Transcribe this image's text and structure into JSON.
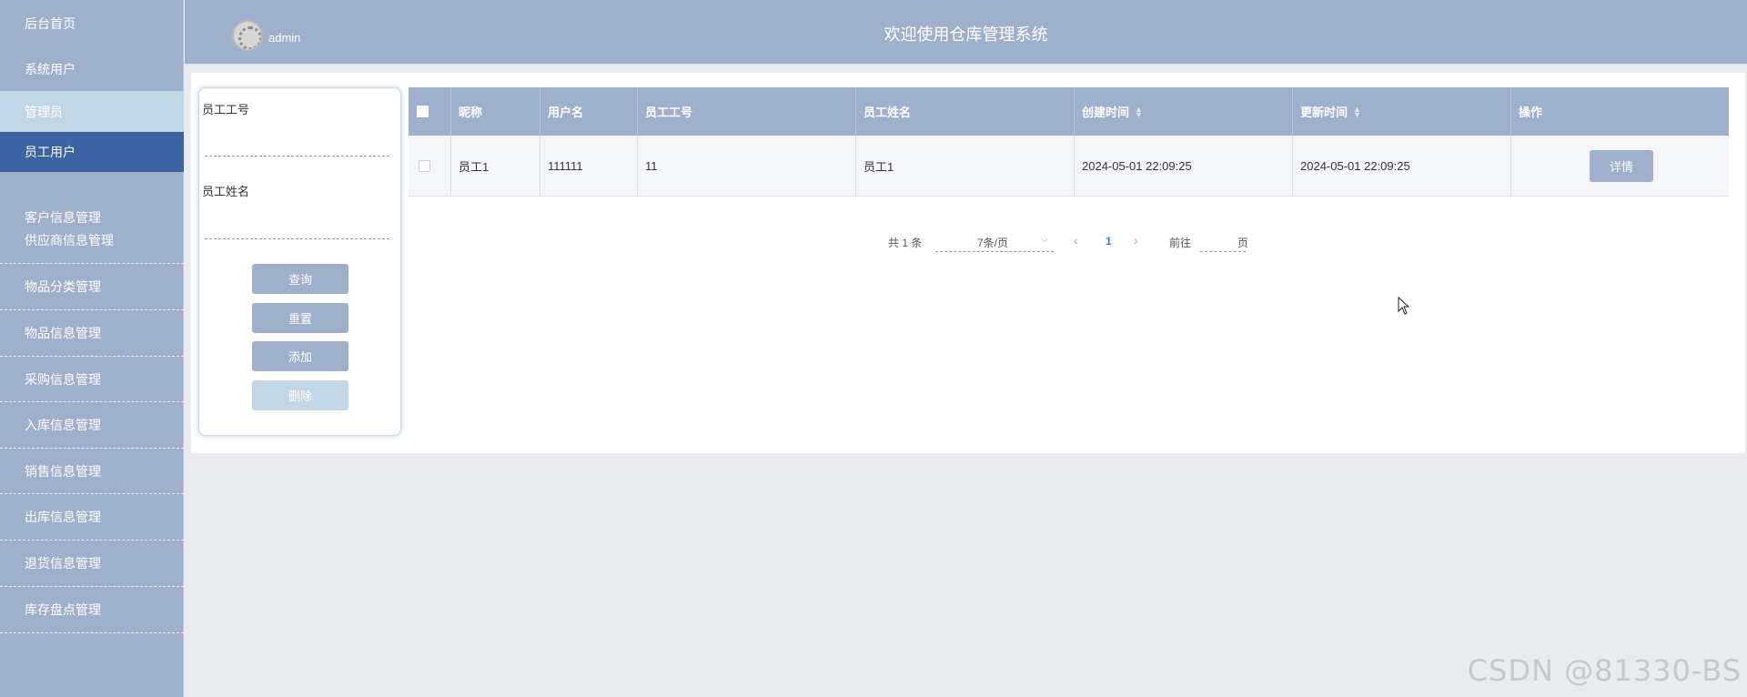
{
  "sidebar": {
    "items": [
      {
        "label": "后台首页"
      },
      {
        "label": "系统用户"
      },
      {
        "label": "管理员"
      },
      {
        "label": "员工用户"
      },
      {
        "label": "客户信息管理"
      },
      {
        "label": "供应商信息管理"
      },
      {
        "label": "物品分类管理"
      },
      {
        "label": "物品信息管理"
      },
      {
        "label": "采购信息管理"
      },
      {
        "label": "入库信息管理"
      },
      {
        "label": "销售信息管理"
      },
      {
        "label": "出库信息管理"
      },
      {
        "label": "退货信息管理"
      },
      {
        "label": "库存盘点管理"
      }
    ],
    "active": "员工用户"
  },
  "header": {
    "username": "admin",
    "title": "欢迎使用仓库管理系统"
  },
  "search": {
    "employee_no_label": "员工工号",
    "employee_no_value": "",
    "employee_name_label": "员工姓名",
    "employee_name_value": "",
    "query_btn": "查询",
    "reset_btn": "重置",
    "add_btn": "添加",
    "delete_btn": "删除"
  },
  "table": {
    "columns": [
      "昵称",
      "用户名",
      "员工工号",
      "员工姓名",
      "创建时间",
      "更新时间",
      "操作"
    ],
    "rows": [
      {
        "nickname": "员工1",
        "username": "111111",
        "employee_no": "11",
        "employee_name": "员工1",
        "created": "2024-05-01 22:09:25",
        "updated": "2024-05-01 22:09:25",
        "action": "详情"
      }
    ]
  },
  "pagination": {
    "total_text": "共 1 条",
    "page_size": "7条/页",
    "current_page": "1",
    "goto_label": "前往",
    "page_unit": "页",
    "goto_value": ""
  },
  "watermark": "CSDN @81330-BS",
  "colors": {
    "primary": "#9fb0cc",
    "active_nav": "#3c63a3",
    "sub_active_nav": "#c3d6e6"
  }
}
